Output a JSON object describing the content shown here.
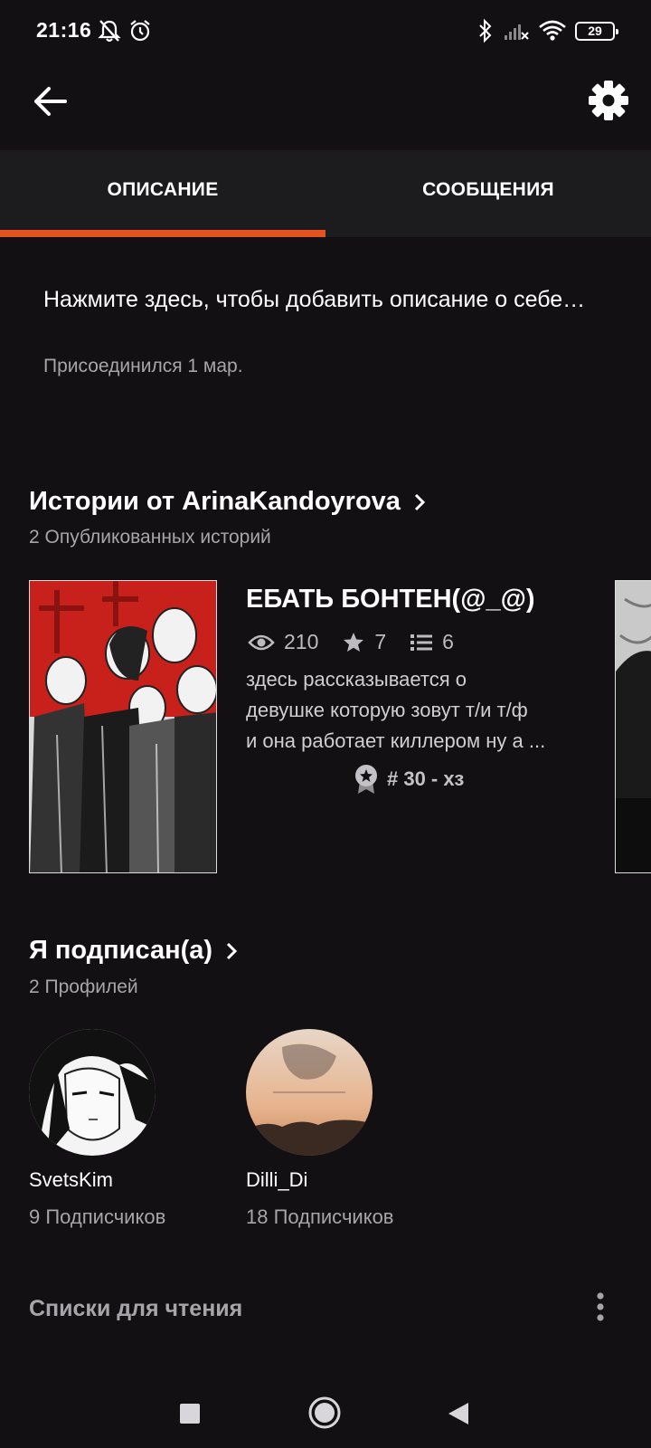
{
  "status_bar": {
    "time": "21:16",
    "battery": "29",
    "icons": [
      "notifications-off-icon",
      "alarm-icon",
      "bluetooth-icon",
      "signal-off-icon",
      "wifi-icon",
      "battery-icon"
    ]
  },
  "app_bar": {
    "back_icon": "arrow-left-icon",
    "settings_icon": "gear-icon"
  },
  "tabs": [
    {
      "label": "ОПИСАНИЕ",
      "active": true
    },
    {
      "label": "СООБЩЕНИЯ",
      "active": false
    }
  ],
  "accent_color": "#e4531f",
  "about": {
    "prompt": "Нажмите здесь, чтобы добавить описание о себе…",
    "joined": "Присоединился 1 мар."
  },
  "stories": {
    "title": "Истории от ArinaKandoyrova",
    "count_label": "2 Опубликованных историй",
    "items": [
      {
        "title": "ЕБАТЬ БОНТЕН(@_@)",
        "views": "210",
        "votes": "7",
        "parts": "6",
        "description_lines": [
          "здесь рассказывается о",
          "девушке которую зовут т/и т/ф",
          "и она работает киллером  ну а ..."
        ],
        "rank": "# 30 - хз"
      }
    ]
  },
  "following": {
    "title": "Я подписан(а)",
    "count_label": "2 Профилей",
    "profiles": [
      {
        "name": "SvetsKim",
        "followers": "9 Подписчиков"
      },
      {
        "name": "Dilli_Di",
        "followers": "18 Подписчиков"
      }
    ]
  },
  "reading_lists": {
    "title": "Списки для чтения"
  },
  "nav_bar": {
    "icons": [
      "recents-square-icon",
      "home-circle-icon",
      "back-triangle-icon"
    ]
  }
}
